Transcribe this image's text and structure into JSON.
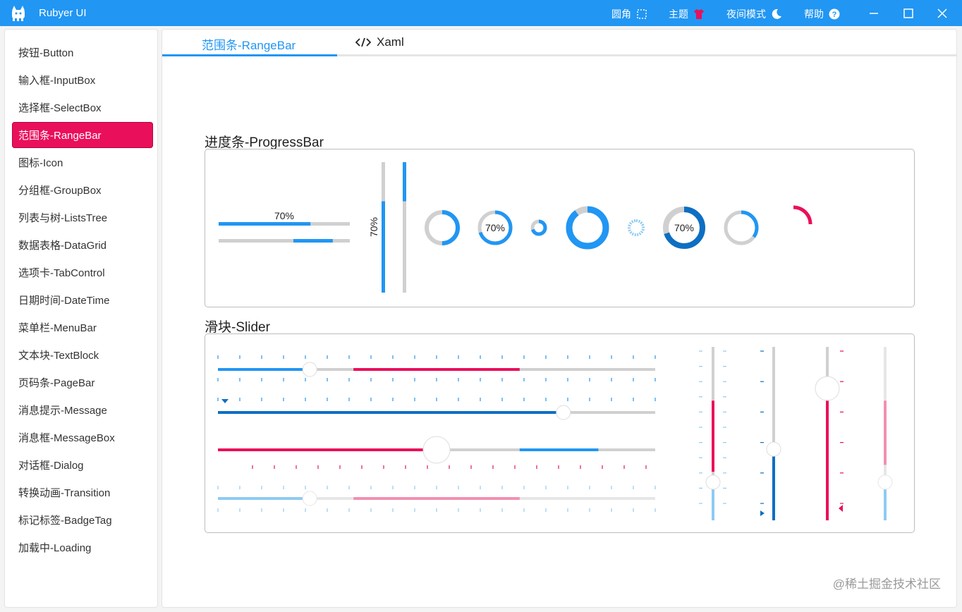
{
  "app": {
    "title": "Rubyer UI",
    "toolbar": [
      {
        "label": "圆角",
        "icon": "corner-radius-icon"
      },
      {
        "label": "主题",
        "icon": "shirt-icon"
      },
      {
        "label": "夜间模式",
        "icon": "moon-icon"
      },
      {
        "label": "帮助",
        "icon": "help-icon"
      }
    ]
  },
  "sidebar": {
    "items": [
      {
        "label": "按钮-Button"
      },
      {
        "label": "输入框-InputBox"
      },
      {
        "label": "选择框-SelectBox"
      },
      {
        "label": "范围条-RangeBar",
        "active": true
      },
      {
        "label": "图标-Icon"
      },
      {
        "label": "分组框-GroupBox"
      },
      {
        "label": "列表与树-ListsTree"
      },
      {
        "label": "数据表格-DataGrid"
      },
      {
        "label": "选项卡-TabControl"
      },
      {
        "label": "日期时间-DateTime"
      },
      {
        "label": "菜单栏-MenuBar"
      },
      {
        "label": "文本块-TextBlock"
      },
      {
        "label": "页码条-PageBar"
      },
      {
        "label": "消息提示-Message"
      },
      {
        "label": "消息框-MessageBox"
      },
      {
        "label": "对话框-Dialog"
      },
      {
        "label": "转换动画-Transition"
      },
      {
        "label": "标记标签-BadgeTag"
      },
      {
        "label": "加载中-Loading"
      }
    ]
  },
  "tabs": [
    {
      "label": "范围条-RangeBar",
      "active": true
    },
    {
      "label": "Xaml",
      "icon": "code-icon"
    }
  ],
  "progress_section": {
    "title": "进度条-ProgressBar",
    "bars": [
      {
        "orientation": "horizontal",
        "value": 0.7,
        "label": "70%"
      },
      {
        "orientation": "horizontal",
        "range": [
          0.57,
          0.87
        ]
      },
      {
        "orientation": "vertical",
        "value": 0.7,
        "label": "70%"
      },
      {
        "orientation": "vertical",
        "range": [
          0.7,
          1.0
        ]
      }
    ],
    "rings": [
      {
        "value": 0.5
      },
      {
        "value": 0.7,
        "label": "70%"
      },
      {
        "value": 0.7
      },
      {
        "value": 0.9
      },
      {
        "value": 0.7
      },
      {
        "value": 0.7,
        "label": "70%"
      },
      {
        "value": 0.35
      },
      {
        "value": 0.25
      }
    ]
  },
  "slider_section": {
    "title": "滑块-Slider",
    "horizontal": [
      {
        "value": 0.21,
        "range": [
          0.31,
          0.69
        ]
      },
      {
        "value": 0.79
      },
      {
        "value": 0.5,
        "range": [
          0.69,
          0.87
        ]
      },
      {
        "value": 0.21,
        "range": [
          0.31,
          0.69
        ]
      }
    ],
    "vertical": [
      {
        "value": 0.22,
        "range": [
          0.28,
          0.69
        ]
      },
      {
        "value": 0.41
      },
      {
        "value": 0.76
      },
      {
        "value": 0.22,
        "range": [
          0.32,
          0.69
        ]
      }
    ]
  },
  "colors": {
    "primary": "#2196f3",
    "dark_primary": "#0d6fc3",
    "light_primary": "#8ecbf3",
    "accent": "#ea0f5b",
    "light_accent": "#f48fb1",
    "track": "#d0d0d0"
  },
  "watermark": "@稀土掘金技术社区"
}
